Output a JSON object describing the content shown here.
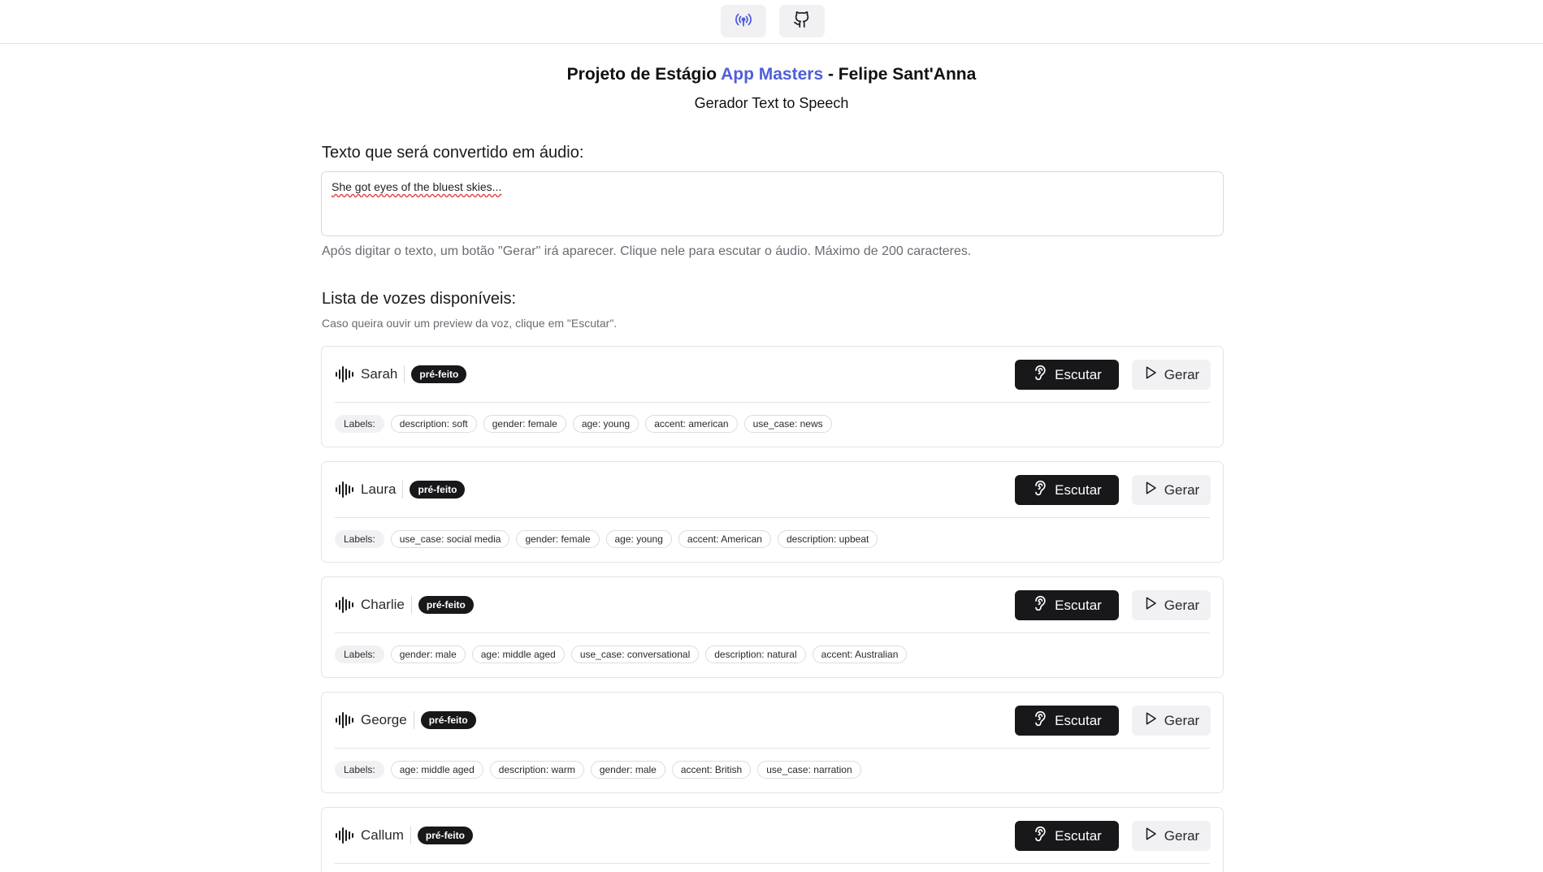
{
  "header": {
    "icons": [
      "broadcast-icon",
      "github-icon"
    ]
  },
  "page": {
    "title_prefix": "Projeto de Estágio ",
    "title_accent": "App Masters",
    "title_suffix": " - Felipe Sant'Anna",
    "subtitle": "Gerador Text to Speech",
    "accent_color": "#4f5fd8"
  },
  "text_input": {
    "label": "Texto que será convertido em áudio:",
    "value": "She got eyes of the bluest skies...",
    "helper": "Após digitar o texto, um botão \"Gerar\" irá aparecer. Clique nele para escutar o áudio. Máximo de 200 caracteres."
  },
  "voices": {
    "heading": "Lista de vozes disponíveis:",
    "hint": "Caso queira ouvir um preview da voz, clique em \"Escutar\".",
    "listen_label": "Escutar",
    "generate_label": "Gerar",
    "labels_title": "Labels:",
    "items": [
      {
        "name": "Sarah",
        "badge": "pré-feito",
        "labels": [
          "description: soft",
          "gender: female",
          "age: young",
          "accent: american",
          "use_case: news"
        ]
      },
      {
        "name": "Laura",
        "badge": "pré-feito",
        "labels": [
          "use_case: social media",
          "gender: female",
          "age: young",
          "accent: American",
          "description: upbeat"
        ]
      },
      {
        "name": "Charlie",
        "badge": "pré-feito",
        "labels": [
          "gender: male",
          "age: middle aged",
          "use_case: conversational",
          "description: natural",
          "accent: Australian"
        ]
      },
      {
        "name": "George",
        "badge": "pré-feito",
        "labels": [
          "age: middle aged",
          "description: warm",
          "gender: male",
          "accent: British",
          "use_case: narration"
        ]
      },
      {
        "name": "Callum",
        "badge": "pré-feito",
        "labels": [
          "",
          "",
          "",
          "",
          ""
        ]
      }
    ]
  }
}
